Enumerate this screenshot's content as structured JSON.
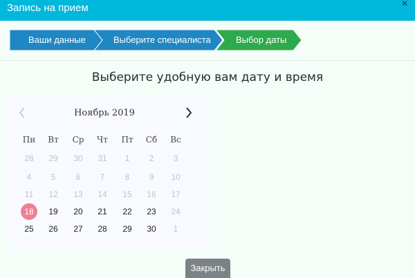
{
  "window": {
    "title": "Запись на прием",
    "close_glyph": "×"
  },
  "steps": [
    {
      "label": "Ваши данные",
      "color": "#1f87c3",
      "state": "done"
    },
    {
      "label": "Выберите специалиста",
      "color": "#1f87c3",
      "state": "done"
    },
    {
      "label": "Выбор даты",
      "color": "#2daa4d",
      "state": "active"
    }
  ],
  "heading": "Выберите удобную вам дату и время",
  "calendar": {
    "month_label": "Ноябрь 2019",
    "prev_icon": "chevron-left-icon",
    "next_icon": "chevron-right-icon",
    "weekdays": [
      "Пн",
      "Вт",
      "Ср",
      "Чт",
      "Пт",
      "Сб",
      "Вс"
    ],
    "weeks": [
      [
        {
          "d": "28",
          "muted": true
        },
        {
          "d": "29",
          "muted": true
        },
        {
          "d": "30",
          "muted": true
        },
        {
          "d": "31",
          "muted": true
        },
        {
          "d": "1",
          "muted": true
        },
        {
          "d": "2",
          "muted": true
        },
        {
          "d": "3",
          "muted": true
        }
      ],
      [
        {
          "d": "4",
          "muted": true
        },
        {
          "d": "5",
          "muted": true
        },
        {
          "d": "6",
          "muted": true
        },
        {
          "d": "7",
          "muted": true
        },
        {
          "d": "8",
          "muted": true
        },
        {
          "d": "9",
          "muted": true
        },
        {
          "d": "10",
          "muted": true
        }
      ],
      [
        {
          "d": "11",
          "muted": true
        },
        {
          "d": "12",
          "muted": true
        },
        {
          "d": "13",
          "muted": true
        },
        {
          "d": "14",
          "muted": true
        },
        {
          "d": "15",
          "muted": true
        },
        {
          "d": "16",
          "muted": true
        },
        {
          "d": "17",
          "muted": true
        }
      ],
      [
        {
          "d": "18",
          "selected": true
        },
        {
          "d": "19"
        },
        {
          "d": "20"
        },
        {
          "d": "21"
        },
        {
          "d": "22"
        },
        {
          "d": "23"
        },
        {
          "d": "24",
          "muted": true
        }
      ],
      [
        {
          "d": "25"
        },
        {
          "d": "26"
        },
        {
          "d": "27"
        },
        {
          "d": "28"
        },
        {
          "d": "29"
        },
        {
          "d": "30"
        },
        {
          "d": "1",
          "muted": true
        }
      ]
    ],
    "selected_color": "#f07f94"
  },
  "footer": {
    "close_label": "Закрыть"
  },
  "colors": {
    "titlebar": "#00b7dc",
    "background": "#f4fdf8",
    "step_blue": "#1f87c3",
    "step_green": "#2daa4d",
    "button": "#7d8288"
  }
}
